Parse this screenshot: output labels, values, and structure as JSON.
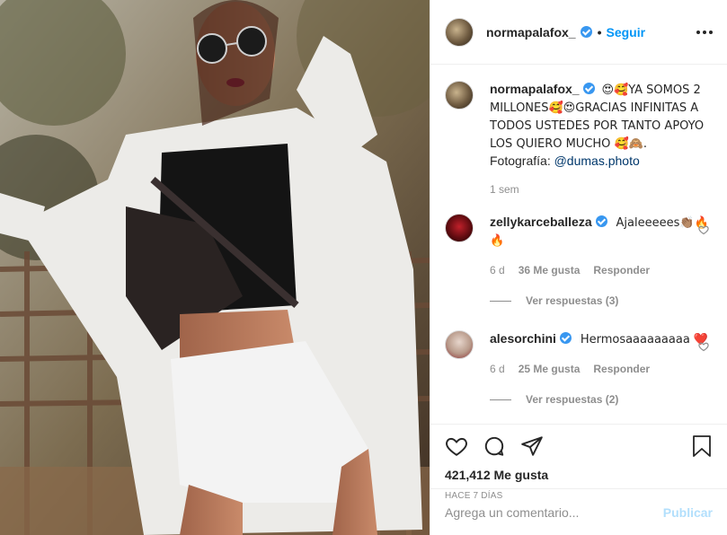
{
  "post": {
    "username": "normapalafox_",
    "follow_label": "Seguir",
    "separator": "•"
  },
  "caption": {
    "username": "normapalafox_",
    "text_1": "😍🥰YA SOMOS 2 MILLONES🥰😍GRACIAS INFINITAS A TODOS USTEDES POR TANTO APOYO LOS QUIERO MUCHO 🥰🙈.",
    "photo_prefix": "Fotografía: ",
    "photo_link": "@dumas.photo",
    "time": "1 sem"
  },
  "comments": [
    {
      "username": "zellykarceballeza",
      "text": "Ajaleeeees👏🏽🔥🔥",
      "time": "6 d",
      "likes": "36 Me gusta",
      "reply": "Responder",
      "replies": "Ver respuestas (3)"
    },
    {
      "username": "alesorchini",
      "text": "Hermosaaaaaaaaa ❤️",
      "time": "6 d",
      "likes": "25 Me gusta",
      "reply": "Responder",
      "replies": "Ver respuestas (2)"
    }
  ],
  "stats": {
    "likes": "421,412 Me gusta",
    "time": "HACE 7 DÍAS"
  },
  "composer": {
    "placeholder": "Agrega un comentario...",
    "publish": "Publicar"
  },
  "colors": {
    "accent": "#0095f6",
    "verified": "#3897f0",
    "publish_disabled": "#b2dffc"
  }
}
